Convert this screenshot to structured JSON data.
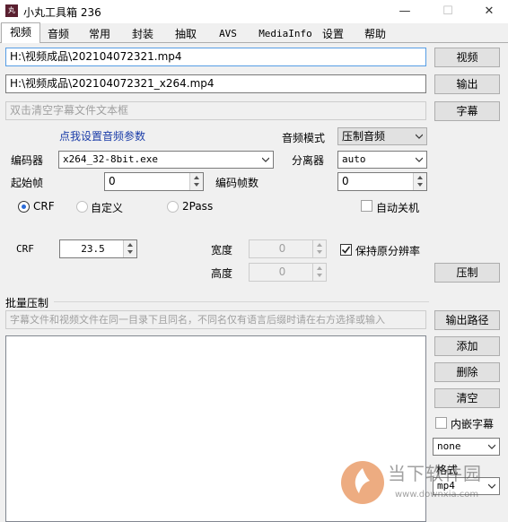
{
  "window": {
    "title": "小丸工具箱 236",
    "icon_text": "丸",
    "controls": {
      "minimize": "—",
      "maximize": "☐",
      "close": "✕"
    }
  },
  "tabs": [
    "视频",
    "音频",
    "常用",
    "封装",
    "抽取",
    "AVS",
    "MediaInfo",
    "设置",
    "帮助"
  ],
  "video": {
    "input_path": "H:\\视频成品\\202104072321.mp4",
    "output_path": "H:\\视频成品\\202104072321_x264.mp4",
    "subtitle_placeholder": "双击清空字幕文件文本框",
    "btn_video": "视频",
    "btn_output": "输出",
    "btn_subtitle": "字幕",
    "audio_settings_link": "点我设置音频参数",
    "audio_mode_label": "音频模式",
    "audio_mode_value": "压制音频",
    "encoder_label": "编码器",
    "encoder_value": "x264_32-8bit.exe",
    "splitter_label": "分离器",
    "splitter_value": "auto",
    "start_frame_label": "起始帧",
    "start_frame_value": "0",
    "encode_frames_label": "编码帧数",
    "encode_frames_value": "0",
    "radio_crf": "CRF",
    "radio_custom": "自定义",
    "radio_2pass": "2Pass",
    "auto_shutdown": "自动关机",
    "crf_label": "CRF",
    "crf_value": "23.5",
    "width_label": "宽度",
    "width_value": "0",
    "height_label": "高度",
    "height_value": "0",
    "keep_resolution": "保持原分辨率",
    "btn_compress": "压制"
  },
  "batch": {
    "title": "批量压制",
    "hint": "字幕文件和视频文件在同一目录下且同名，不同名仅有语言后缀时请在右方选择或输入",
    "btn_output_path": "输出路径",
    "btn_add": "添加",
    "btn_delete": "删除",
    "btn_clear": "清空",
    "embed_subtitle": "内嵌字幕",
    "subtitle_lang_value": "none",
    "format_label": "格式",
    "format_value": "mp4"
  },
  "watermark": {
    "text": "当下软件园",
    "url": "www.downxia.com"
  },
  "colors": {
    "link": "#1a3ca8",
    "focus_border": "#569de5",
    "radio_dot": "#2a6bd8",
    "watermark_orange": "#e06a1b"
  }
}
